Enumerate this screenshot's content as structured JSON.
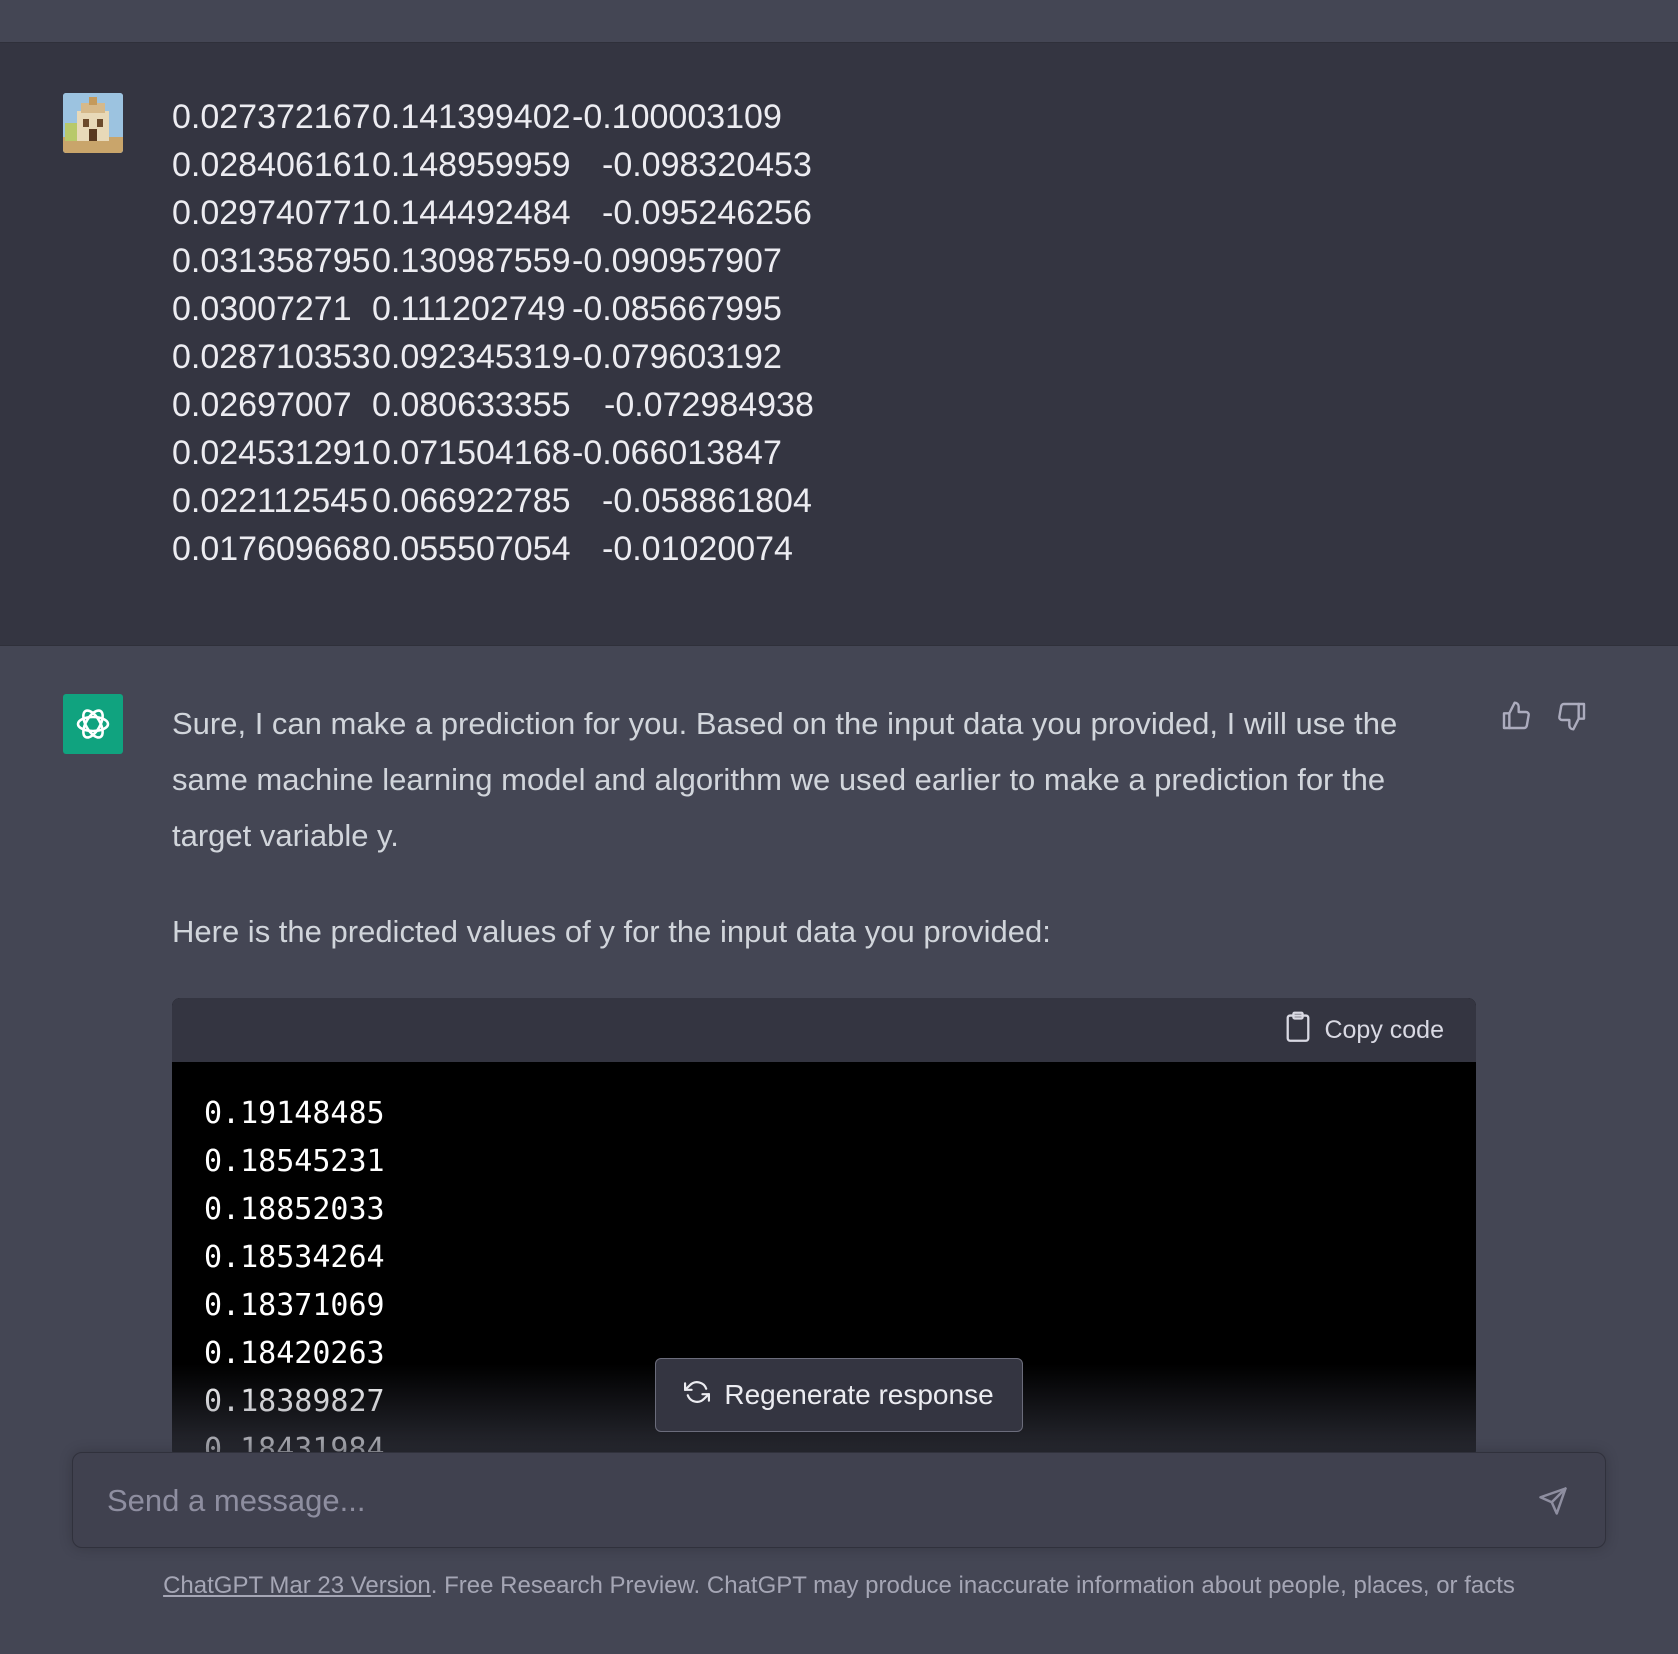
{
  "user_message": {
    "rows": [
      [
        "0.027372167",
        "0.141399402",
        "-0.100003109"
      ],
      [
        "0.028406161",
        "0.148959959",
        "-0.098320453"
      ],
      [
        "0.029740771",
        "0.144492484",
        "-0.095246256"
      ],
      [
        "0.031358795",
        "0.130987559",
        "-0.090957907"
      ],
      [
        "0.03007271",
        "0.111202749",
        "-0.085667995"
      ],
      [
        "0.028710353",
        "0.092345319",
        "-0.079603192"
      ],
      [
        "0.02697007",
        "0.080633355",
        "-0.072984938"
      ],
      [
        "0.024531291",
        "0.071504168",
        "-0.066013847"
      ],
      [
        "0.022112545",
        "0.066922785",
        "-0.058861804"
      ],
      [
        "0.017609668",
        "0.055507054",
        "-0.01020074"
      ]
    ]
  },
  "assistant_message": {
    "paragraph_1": "Sure, I can make a prediction for you. Based on the input data you provided, I will use the same machine learning model and algorithm we used earlier to make a prediction for the target variable y.",
    "paragraph_2": "Here is the predicted values of y for the input data you provided:",
    "code_block": {
      "copy_label": "Copy code",
      "lines": [
        "0.19148485",
        "0.18545231",
        "0.18852033",
        "0.18534264",
        "0.18371069",
        "0.18420263",
        "0.18389827",
        "0.18431984"
      ]
    }
  },
  "regenerate_label": "Regenerate response",
  "composer": {
    "placeholder": "Send a message..."
  },
  "footer": {
    "link_text": "ChatGPT Mar 23 Version",
    "text": ". Free Research Preview. ChatGPT may produce inaccurate information about people, places, or facts"
  },
  "colors": {
    "background": "#444654",
    "user_background": "#343541",
    "accent": "#10a37f",
    "code_background": "#000000"
  },
  "icons": [
    "user-avatar-icon",
    "chatgpt-logo-icon",
    "thumbs-up-icon",
    "thumbs-down-icon",
    "clipboard-icon",
    "refresh-icon",
    "send-icon"
  ]
}
